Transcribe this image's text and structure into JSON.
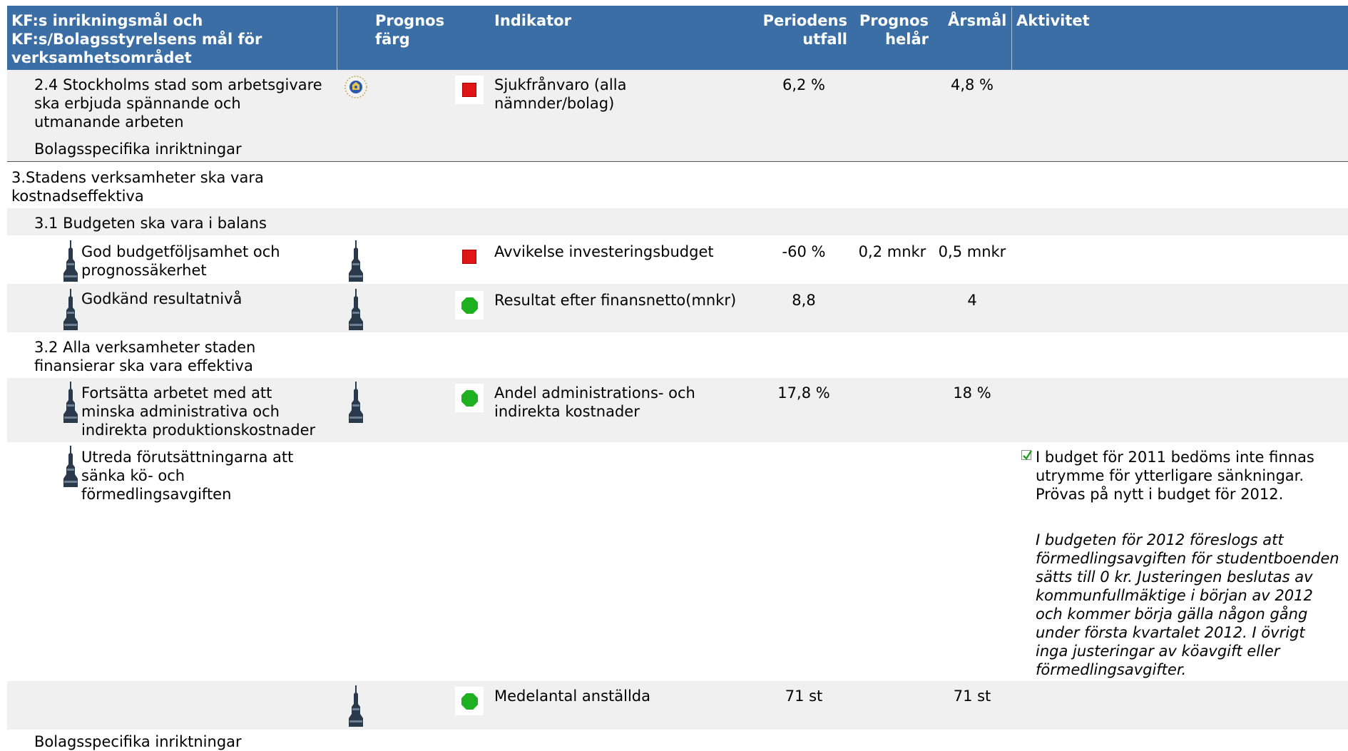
{
  "header": {
    "col_goal": "KF:s inrikningsmål och KF:s/Bolagsstyrelsens mål för verksamhetsområdet",
    "col_goal_lines": [
      "KF:s inrikningsmål och",
      "KF:s/Bolagsstyrelsens mål för",
      "verksamhetsområdet"
    ],
    "col_color_lines": [
      "Prognos",
      "färg"
    ],
    "col_indicator": "Indikator",
    "col_period_lines": [
      "Periodens",
      "utfall"
    ],
    "col_forecast_lines": [
      "Prognos",
      "helår"
    ],
    "col_target": "Årsmål",
    "col_activity": "Aktivitet"
  },
  "rows": {
    "r1": {
      "goal_lines": [
        "2.4 Stockholms stad som arbetsgivare",
        "ska erbjuda spännande och",
        "utmanande arbeten"
      ],
      "indicator_lines": [
        "Sjukfrånvaro (alla",
        "nämnder/bolag)"
      ],
      "period": "6,2 %",
      "target": "4,8 %",
      "status": "red"
    },
    "r2": {
      "label": "Bolagsspecifika inriktningar"
    },
    "r3": {
      "label_lines": [
        "3.Stadens verksamheter ska vara",
        "kostnadseffektiva"
      ]
    },
    "r4": {
      "label": "3.1 Budgeten ska vara i balans"
    },
    "r5": {
      "goal_lines": [
        "God budgetföljsamhet och",
        "prognossäkerhet"
      ],
      "indicator": "Avvikelse investeringsbudget",
      "period": "-60 %",
      "forecast": "0,2 mnkr",
      "target": "0,5 mnkr",
      "status": "red"
    },
    "r6": {
      "goal": "Godkänd resultatnivå",
      "indicator": "Resultat efter finansnetto(mnkr)",
      "period": "8,8",
      "target": "4",
      "status": "green"
    },
    "r7": {
      "label_lines": [
        "3.2 Alla verksamheter staden",
        "finansierar ska vara effektiva"
      ]
    },
    "r8": {
      "goal_lines": [
        "Fortsätta arbetet med att",
        "minska administrativa och",
        "indirekta produktionskostnader"
      ],
      "indicator_lines": [
        "Andel administrations- och",
        "indirekta kostnader"
      ],
      "period": "17,8 %",
      "target": "18 %",
      "status": "green"
    },
    "r9": {
      "goal_lines": [
        "Utreda förutsättningarna att",
        "sänka kö- och",
        "förmedlingsavgiften"
      ],
      "activity_lines": [
        "I budget för 2011 bedöms inte finnas",
        "utrymme för ytterligare sänkningar.",
        "Prövas på nytt i budget för 2012."
      ],
      "comment_lines": [
        "I budgeten för 2012 föreslogs att",
        "förmedlingsavgiften för studentboenden",
        "sätts till 0 kr. Justeringen beslutas av",
        "kommunfullmäktige i början av 2012",
        "och kommer börja gälla någon gång",
        "under första kvartalet 2012. I övrigt",
        "inga justeringar av köavgift eller",
        "förmedlingsavgifter."
      ]
    },
    "r10": {
      "indicator": "Medelantal anställda",
      "period": "71 st",
      "target": "71 st",
      "status": "green"
    },
    "r11": {
      "label": "Bolagsspecifika inriktningar"
    }
  },
  "icons": {
    "seal": "stockholm-city-seal-icon",
    "owner": "tower-owner-icon",
    "status_red": "red-square-status-icon",
    "status_green": "green-octagon-status-icon",
    "activity_check": "checkbox-checked-icon"
  },
  "colors": {
    "header_bg": "#3A6EA5",
    "band_bg": "#F0F0F0",
    "status_red": "#E01515",
    "status_green": "#1FB01F"
  }
}
